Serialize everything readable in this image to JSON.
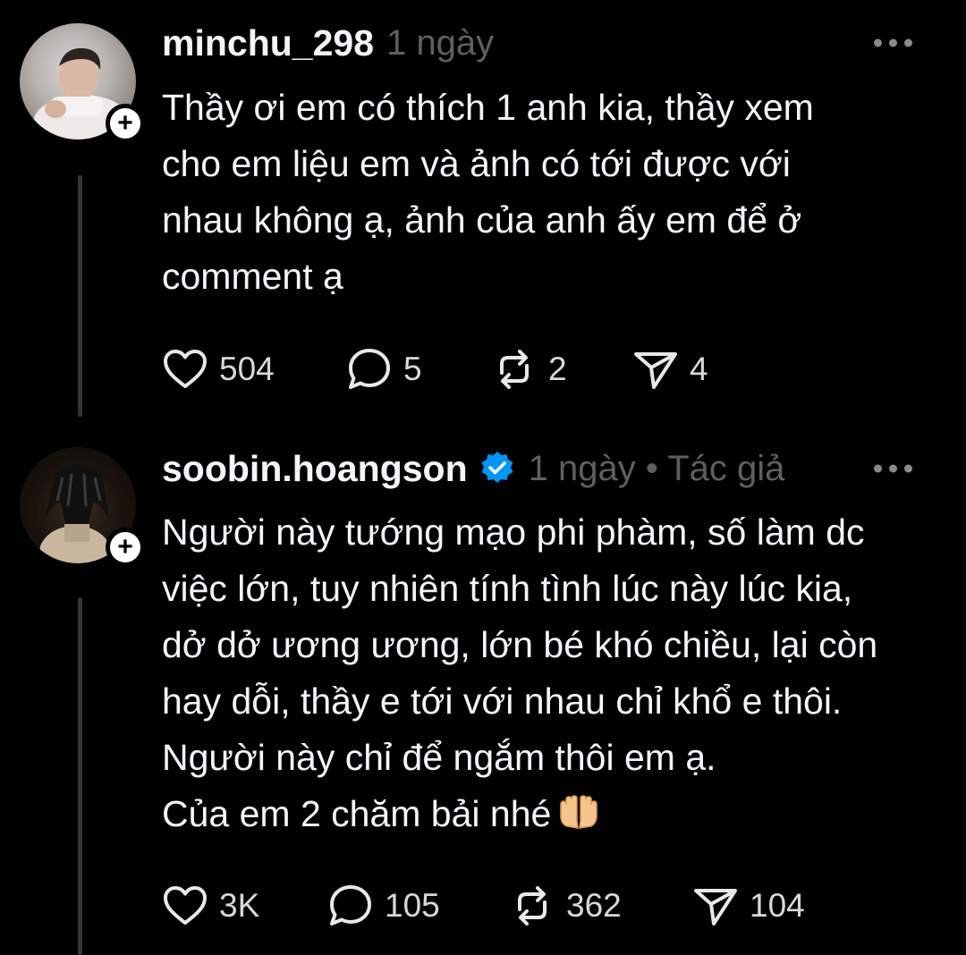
{
  "posts": [
    {
      "username": "minchu_298",
      "time": "1 ngày",
      "lines": [
        "Thầy ơi em có thích 1 anh kia, thầy xem",
        "cho em liệu em và ảnh có tới được với",
        "nhau không ạ, ảnh của anh ấy em để ở",
        "comment ạ"
      ],
      "likes": "504",
      "replies": "5",
      "reposts": "2",
      "shares": "4"
    },
    {
      "username": "soobin.hoangson",
      "verified": true,
      "meta": "1 ngày • Tác giả",
      "lines": [
        "Người này tướng mạo phi phàm, số làm dc",
        "việc lớn, tuy nhiên tính tình lúc này lúc kia,",
        "dở dở ương ương, lớn bé khó chiều, lại còn",
        "hay dỗi, thầy e tới với nhau chỉ khổ e thôi.",
        "Người này chỉ để ngắm thôi em ạ.",
        "Của em 2 chăm bải nhé"
      ],
      "emoji": "palms-up-together",
      "likes": "3K",
      "replies": "105",
      "reposts": "362",
      "shares": "104"
    }
  ],
  "icons": {
    "like": "heart-icon",
    "reply": "comment-bubble-icon",
    "repost": "repost-icon",
    "share": "send-icon",
    "more": "more-dots-icon",
    "follow": "plus-icon",
    "verified": "verified-badge-icon"
  },
  "colors": {
    "background": "#000000",
    "text": "#f3f5f7",
    "muted": "#5f5f5f",
    "verified": "#0095f6",
    "thread_line": "#333638"
  }
}
